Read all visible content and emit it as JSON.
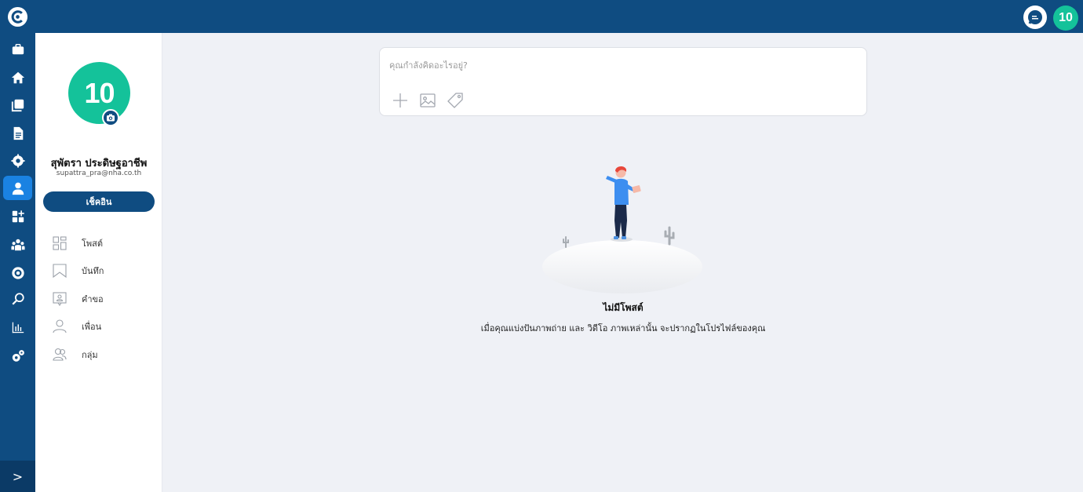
{
  "rail": {
    "items": [
      {
        "name": "briefcase-icon"
      },
      {
        "name": "home-icon"
      },
      {
        "name": "documents-icon"
      },
      {
        "name": "file-icon"
      },
      {
        "name": "settings-cog-icon"
      },
      {
        "name": "user-icon",
        "active": true
      },
      {
        "name": "dashboard-icon"
      },
      {
        "name": "team-icon"
      },
      {
        "name": "gear-badge-icon"
      },
      {
        "name": "search-icon"
      },
      {
        "name": "chart-icon"
      },
      {
        "name": "admin-settings-icon"
      }
    ],
    "expand_label": ">"
  },
  "topbar": {
    "avatar_text": "10"
  },
  "profile": {
    "avatar_text": "10",
    "name": "สุพัตรา ประดิษฐอาชีพ",
    "email": "supattra_pra@nha.co.th",
    "checkin_label": "เช็คอิน"
  },
  "menu": [
    {
      "label": "โพสต์",
      "icon": "posts-grid-icon"
    },
    {
      "label": "บันทึก",
      "icon": "bookmark-icon"
    },
    {
      "label": "คำขอ",
      "icon": "request-icon"
    },
    {
      "label": "เพื่อน",
      "icon": "friend-icon"
    },
    {
      "label": "กลุ่ม",
      "icon": "group-icon"
    }
  ],
  "composer": {
    "placeholder": "คุณกำลังคิดอะไรอยู่?",
    "value": ""
  },
  "empty": {
    "title": "ไม่มีโพสต์",
    "subtitle": "เมื่อคุณแบ่งปันภาพถ่าย และ วิดีโอ ภาพเหล่านั้น จะปรากฏในโปรไฟล์ของคุณ"
  },
  "colors": {
    "brand": "#0f4c81",
    "accent": "#14c29a",
    "active": "#1a82e2"
  }
}
